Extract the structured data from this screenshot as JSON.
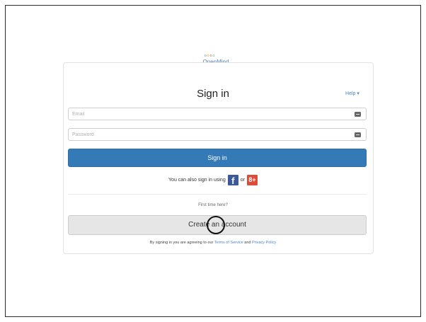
{
  "logo": {
    "dots": [
      "o",
      "o",
      "o",
      "o"
    ],
    "wordmark": "OpenMind"
  },
  "signin": {
    "title": "Sign in",
    "help_label": "Help",
    "help_icon": "chevron-down-icon",
    "email_placeholder": "Email",
    "password_placeholder": "Password",
    "email_value": "",
    "password_value": "",
    "field_icon": "keyboard-icon",
    "submit_label": "Sign in",
    "submit_color": "#337ab7"
  },
  "social": {
    "prefix": "You can also sign in using",
    "facebook_label": "f",
    "facebook_color": "#3b5998",
    "separator": "or",
    "google_label": "8+",
    "google_color": "#dd4b39"
  },
  "register": {
    "prompt": "First time here?",
    "button_label": "Create an account"
  },
  "legal": {
    "prefix": "By signing in you are agreeing to our",
    "terms_label": "Terms of Service",
    "and": "and",
    "privacy_label": "Privacy Policy"
  }
}
